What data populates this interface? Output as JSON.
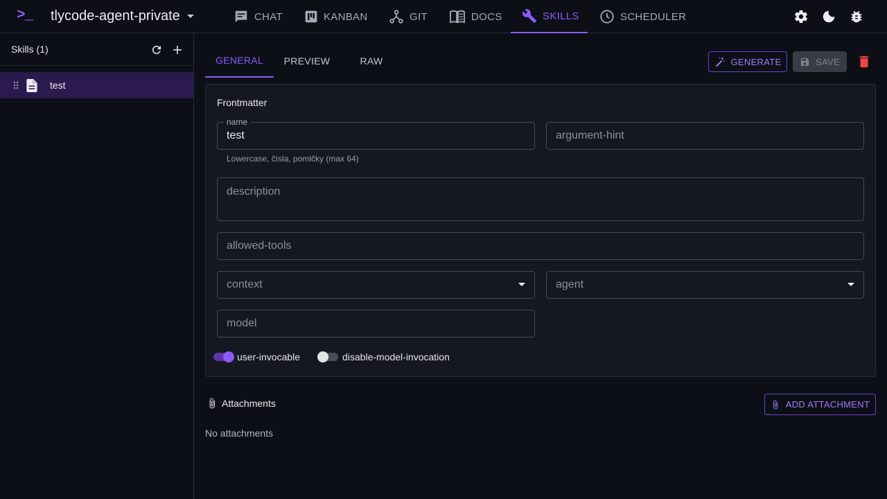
{
  "app": {
    "logo": ">_",
    "project_name": "tlycode-agent-private",
    "accent_color": "#8b5cf6"
  },
  "nav": {
    "tabs": [
      {
        "label": "CHAT",
        "icon": "chat-icon"
      },
      {
        "label": "KANBAN",
        "icon": "kanban-icon"
      },
      {
        "label": "GIT",
        "icon": "git-icon"
      },
      {
        "label": "DOCS",
        "icon": "docs-icon"
      },
      {
        "label": "SKILLS",
        "icon": "wrench-icon",
        "active": true
      },
      {
        "label": "SCHEDULER",
        "icon": "clock-icon"
      }
    ],
    "right_icons": [
      "gear-icon",
      "moon-icon",
      "bug-icon"
    ]
  },
  "sidebar": {
    "title": "Skills (1)",
    "items": [
      {
        "label": "test",
        "selected": true
      }
    ]
  },
  "editor": {
    "tabs": [
      "GENERAL",
      "PREVIEW",
      "RAW"
    ],
    "active_tab": "GENERAL",
    "generate_label": "GENERATE",
    "save_label": "SAVE",
    "save_disabled": true
  },
  "frontmatter": {
    "title": "Frontmatter",
    "name": {
      "label": "name",
      "value": "test",
      "helper": "Lowercase, čísla, pomlčky (max 64)"
    },
    "argument_hint": {
      "placeholder": "argument-hint"
    },
    "description": {
      "placeholder": "description"
    },
    "allowed_tools": {
      "placeholder": "allowed-tools"
    },
    "context": {
      "placeholder": "context"
    },
    "agent": {
      "placeholder": "agent"
    },
    "model": {
      "placeholder": "model"
    },
    "toggles": [
      {
        "label": "user-invocable",
        "checked": true
      },
      {
        "label": "disable-model-invocation",
        "checked": false
      }
    ]
  },
  "attachments": {
    "title": "Attachments",
    "add_label": "ADD ATTACHMENT",
    "empty_text": "No attachments"
  }
}
